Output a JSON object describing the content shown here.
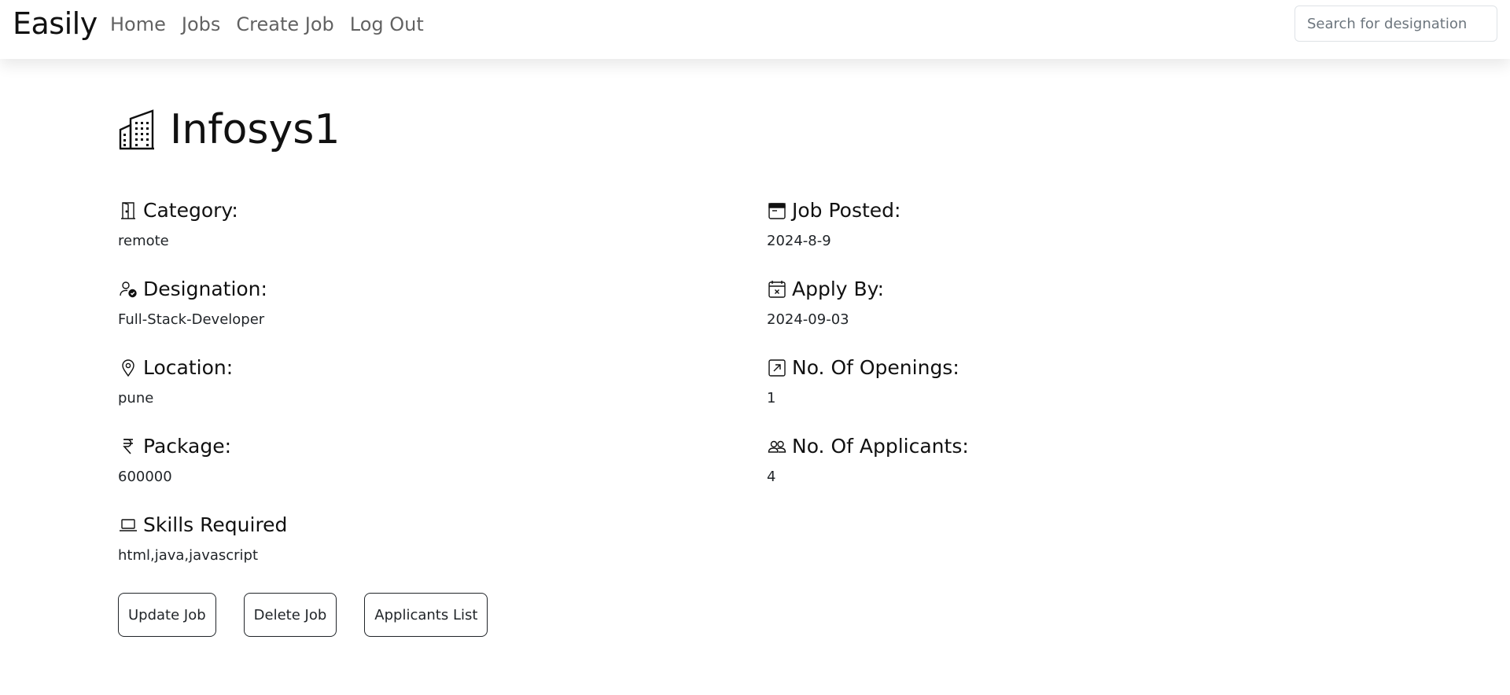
{
  "navbar": {
    "brand": "Easily",
    "links": [
      "Home",
      "Jobs",
      "Create Job",
      "Log Out"
    ],
    "search_placeholder": "Search for designation"
  },
  "job": {
    "title": "Infosys1",
    "fields": {
      "category": {
        "label": "Category:",
        "value": "remote",
        "icon": "door-icon"
      },
      "job_posted": {
        "label": "Job Posted:",
        "value": "2024-8-9",
        "icon": "calendar-icon"
      },
      "designation": {
        "label": "Designation:",
        "value": "Full-Stack-Developer",
        "icon": "person-check-icon"
      },
      "apply_by": {
        "label": "Apply By:",
        "value": "2024-09-03",
        "icon": "calendar-x-icon"
      },
      "location": {
        "label": "Location:",
        "value": "pune",
        "icon": "geo-alt-icon"
      },
      "openings": {
        "label": "No. Of Openings:",
        "value": "1",
        "icon": "arrow-up-right-square-icon"
      },
      "package": {
        "label": "Package:",
        "value": "600000",
        "icon": "currency-rupee-icon"
      },
      "applicants": {
        "label": "No. Of Applicants:",
        "value": "4",
        "icon": "people-icon"
      },
      "skills": {
        "label": "Skills Required",
        "value": "html,java,javascript",
        "icon": "laptop-icon"
      }
    }
  },
  "actions": {
    "update": "Update Job",
    "delete": "Delete Job",
    "applicants_list": "Applicants List"
  }
}
